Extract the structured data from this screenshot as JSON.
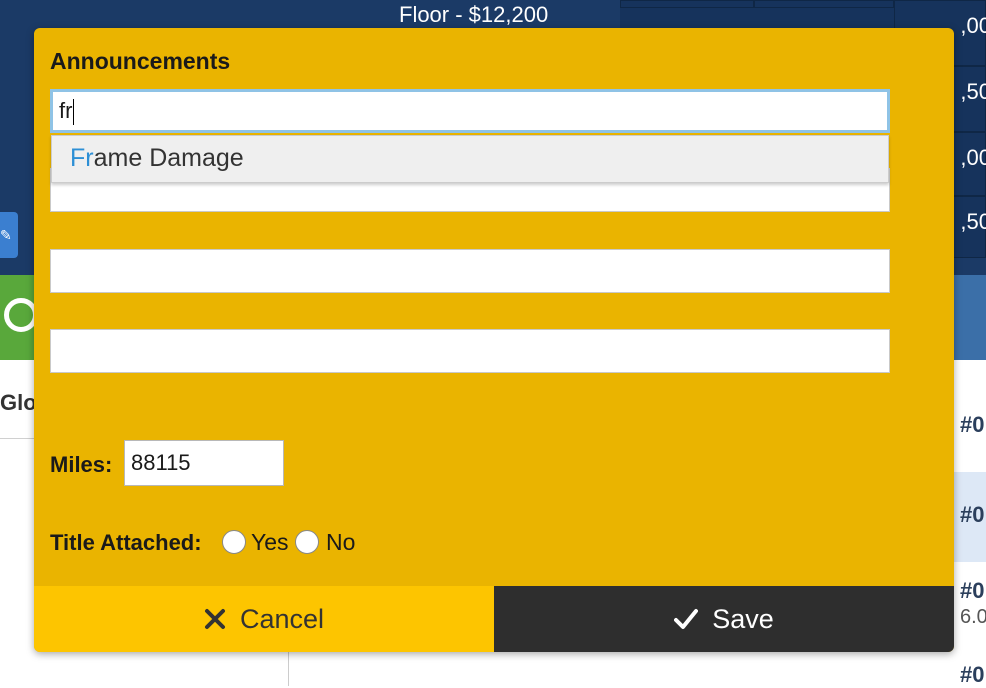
{
  "background": {
    "floor_text": "Floor - $12,200",
    "grid_values": [
      ",00",
      ",50",
      ",00",
      ",50"
    ],
    "partial_heading": "Glo",
    "rows": [
      {
        "id": "#0",
        "sub": ""
      },
      {
        "id": "#0",
        "sub": ""
      },
      {
        "id": "#0",
        "sub": "6.0"
      },
      {
        "id": "#0",
        "sub": ""
      }
    ]
  },
  "modal": {
    "title": "Announcements",
    "announcement_input_value": "fr",
    "autocomplete": {
      "match": "Fr",
      "rest": "ame Damage"
    },
    "miles_label": "Miles:",
    "miles_value": "88115",
    "title_attached_label": "Title Attached:",
    "radio_yes": "Yes",
    "radio_no": "No",
    "cancel_label": "Cancel",
    "save_label": "Save"
  },
  "colors": {
    "modal_bg": "#eab400",
    "cancel_bg": "#fdc500",
    "save_bg": "#2e2e2e",
    "page_header_bg": "#1b3a66",
    "autocomplete_match": "#2d8fd5"
  }
}
